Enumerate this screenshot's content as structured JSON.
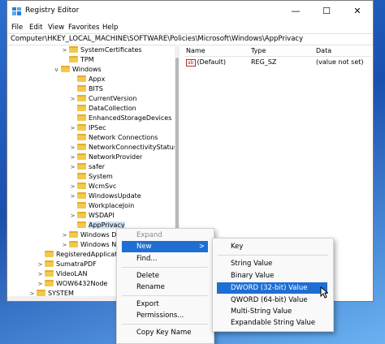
{
  "window": {
    "title": "Registry Editor",
    "controls": {
      "minimize": "—",
      "maximize": "☐",
      "close": "✕"
    }
  },
  "menubar": [
    "File",
    "Edit",
    "View",
    "Favorites",
    "Help"
  ],
  "address": "Computer\\HKEY_LOCAL_MACHINE\\SOFTWARE\\Policies\\Microsoft\\Windows\\AppPrivacy",
  "tree": [
    {
      "label": "SystemCertificates",
      "chevron": ">"
    },
    {
      "label": "TPM",
      "chevron": ""
    },
    {
      "label": "Windows",
      "chevron": "v"
    },
    {
      "label": "Appx",
      "chevron": ""
    },
    {
      "label": "BITS",
      "chevron": ""
    },
    {
      "label": "CurrentVersion",
      "chevron": ">"
    },
    {
      "label": "DataCollection",
      "chevron": ""
    },
    {
      "label": "EnhancedStorageDevices",
      "chevron": ""
    },
    {
      "label": "IPSec",
      "chevron": ">"
    },
    {
      "label": "Network Connections",
      "chevron": ""
    },
    {
      "label": "NetworkConnectivityStatusInd",
      "chevron": ">"
    },
    {
      "label": "NetworkProvider",
      "chevron": ">"
    },
    {
      "label": "safer",
      "chevron": ">"
    },
    {
      "label": "System",
      "chevron": ""
    },
    {
      "label": "WcmSvc",
      "chevron": ">"
    },
    {
      "label": "WindowsUpdate",
      "chevron": ">"
    },
    {
      "label": "WorkplaceJoin",
      "chevron": ""
    },
    {
      "label": "WSDAPI",
      "chevron": ">"
    },
    {
      "label": "AppPrivacy",
      "chevron": ""
    },
    {
      "label": "Windows Defe",
      "chevron": ">"
    },
    {
      "label": "Windows NT",
      "chevron": ">"
    },
    {
      "label": "RegisteredApplicatio",
      "chevron": ""
    },
    {
      "label": "SumatraPDF",
      "chevron": ">"
    },
    {
      "label": "VideoLAN",
      "chevron": ">"
    },
    {
      "label": "WOW6432Node",
      "chevron": ">"
    },
    {
      "label": "SYSTEM",
      "chevron": ">"
    }
  ],
  "list": {
    "columns": {
      "name": "Name",
      "type": "Type",
      "data": "Data"
    },
    "rows": [
      {
        "name": "(Default)",
        "icon": "ab",
        "type": "REG_SZ",
        "data": "(value not set)"
      }
    ]
  },
  "context_menu": {
    "items": [
      "Expand",
      "New",
      "Find...",
      "Delete",
      "Rename",
      "Export",
      "Permissions...",
      "Copy Key Name"
    ],
    "submenu_arrow": ">"
  },
  "new_submenu": {
    "items": [
      "Key",
      "String Value",
      "Binary Value",
      "DWORD (32-bit) Value",
      "QWORD (64-bit) Value",
      "Multi-String Value",
      "Expandable String Value"
    ]
  },
  "colors": {
    "highlight": "#1e6ed4",
    "selection": "#cfe2f7",
    "folder": "#f3c84b"
  }
}
